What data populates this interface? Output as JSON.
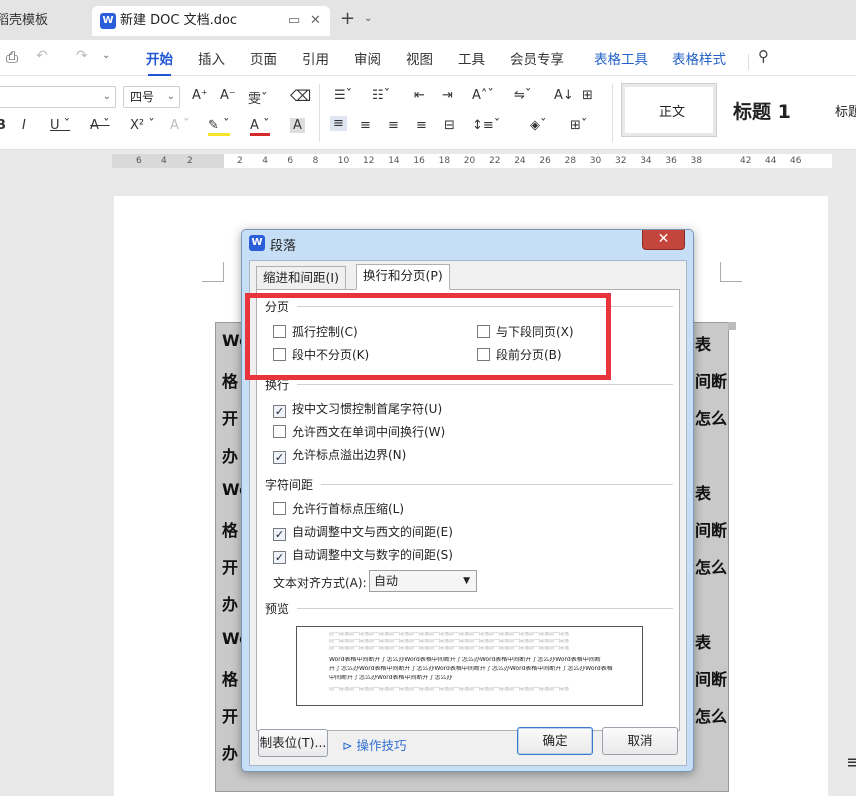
{
  "tabs": [
    {
      "label": "稻壳模板",
      "active": false
    },
    {
      "label": "新建 DOC 文档.doc",
      "active": true
    }
  ],
  "menu": {
    "items": [
      "开始",
      "插入",
      "页面",
      "引用",
      "审阅",
      "视图",
      "工具",
      "会员专享",
      "表格工具",
      "表格样式"
    ],
    "active": "开始"
  },
  "ribbon": {
    "font_size": "四号",
    "styles": [
      "正文",
      "标题 1",
      "标题"
    ]
  },
  "ruler": {
    "ticks_left": [
      "6",
      "4",
      "2"
    ],
    "ticks": [
      "2",
      "4",
      "6",
      "8",
      "10",
      "12",
      "14",
      "16",
      "18",
      "20",
      "22",
      "24",
      "26",
      "28",
      "30",
      "32",
      "34",
      "36",
      "38"
    ],
    "ticks_right": [
      "42",
      "44",
      "46"
    ]
  },
  "document": {
    "left_chars": [
      "Wo",
      "格",
      "开",
      "办",
      "Wo",
      "格",
      "开",
      "办",
      "Wo",
      "格",
      "开",
      "办"
    ],
    "right_chars": [
      "表",
      "间断",
      "怎么",
      "",
      "表",
      "间断",
      "怎么",
      "",
      "表",
      "间断",
      "怎么",
      ""
    ]
  },
  "dialog": {
    "title": "段落",
    "close_glyph": "✕",
    "tabs": [
      "缩进和间距(I)",
      "换行和分页(P)"
    ],
    "active_tab": "换行和分页(P)",
    "sections": {
      "pagination": {
        "title": "分页",
        "options": [
          {
            "label": "孤行控制(C)",
            "checked": false
          },
          {
            "label": "与下段同页(X)",
            "checked": false
          },
          {
            "label": "段中不分页(K)",
            "checked": false
          },
          {
            "label": "段前分页(B)",
            "checked": false
          }
        ]
      },
      "line_break": {
        "title": "换行",
        "options": [
          {
            "label": "按中文习惯控制首尾字符(U)",
            "checked": true
          },
          {
            "label": "允许西文在单词中间换行(W)",
            "checked": false
          },
          {
            "label": "允许标点溢出边界(N)",
            "checked": true
          }
        ]
      },
      "char_spacing": {
        "title": "字符间距",
        "options": [
          {
            "label": "允许行首标点压缩(L)",
            "checked": false
          },
          {
            "label": "自动调整中文与西文的间距(E)",
            "checked": true
          },
          {
            "label": "自动调整中文与数字的间距(S)",
            "checked": true
          }
        ],
        "text_align_label": "文本对齐方式(A):",
        "text_align_value": "自动"
      },
      "preview": {
        "title": "预览",
        "grey_text": "前一段落前一段落前一段落前一段落前一段落前一段落前一段落前一段落前一段落前一段落前一段落前一段落",
        "sample_text_1": "Word表格中间断开了怎么办Word表格中间断开了怎么办Word表格中间断开了怎么办Word表格中间断",
        "sample_text_2": "开了怎么办Word表格中间断开了怎么办Word表格中间断开了怎么办Word表格中间断开了怎么办Word表格",
        "sample_text_3": "中间断开了怎么办Word表格中间断开了怎么办"
      }
    },
    "buttons": {
      "tabs_button": "制表位(T)...",
      "tips_link": "操作技巧",
      "ok": "确定",
      "cancel": "取消"
    }
  },
  "colors": {
    "accent": "#1e57d6",
    "highlight_box": "#e7353b",
    "dialog_frame": "#c6dff6"
  }
}
